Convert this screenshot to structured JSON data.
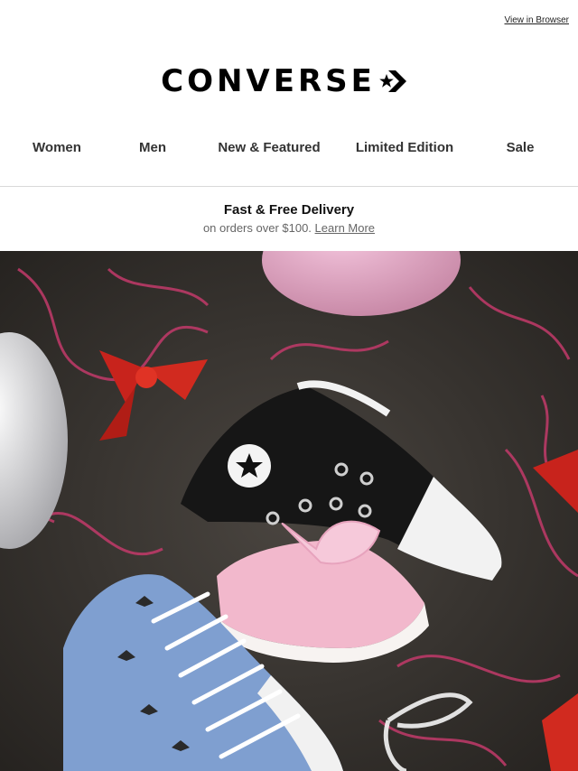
{
  "header": {
    "view_in_browser": "View in Browser",
    "brand": "CONVERSE",
    "logo_icon": "star-chevron-icon"
  },
  "nav": {
    "items": [
      {
        "label": "Women"
      },
      {
        "label": "Men"
      },
      {
        "label": "New & Featured"
      },
      {
        "label": "Limited Edition"
      },
      {
        "label": "Sale"
      }
    ]
  },
  "promo": {
    "title": "Fast & Free Delivery",
    "subtitle": "on orders over $100.",
    "link": "Learn More"
  },
  "colors": {
    "text_primary": "#111111",
    "text_muted": "#666666",
    "divider": "#d9d9d9",
    "hero_background": "#3a3632"
  }
}
